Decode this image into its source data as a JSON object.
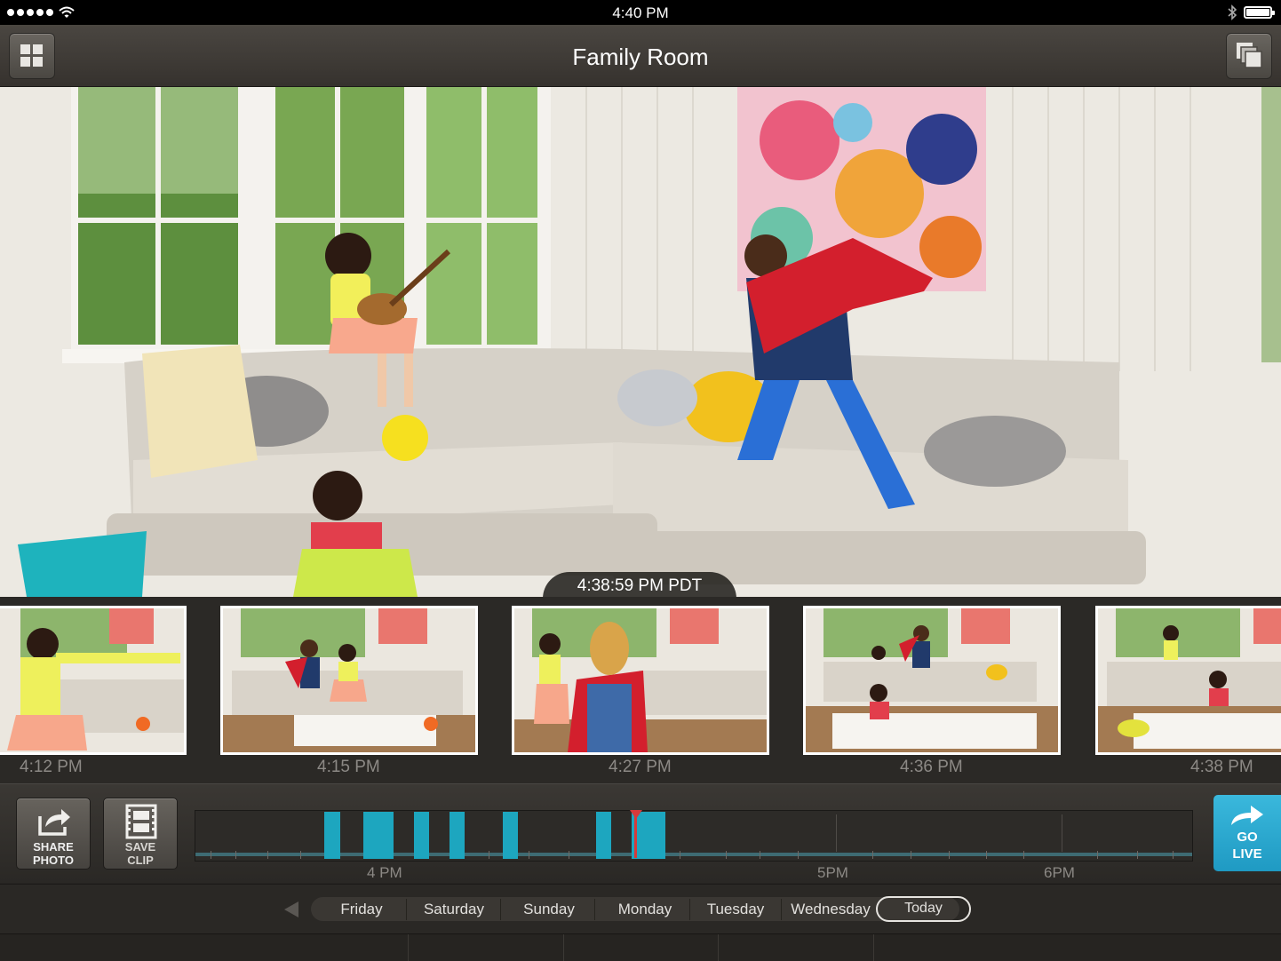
{
  "status_bar": {
    "time": "4:40 PM"
  },
  "header": {
    "title": "Family Room"
  },
  "camera": {
    "timestamp": "4:38:59 PM PDT"
  },
  "thumbnails": [
    {
      "time": "4:12 PM"
    },
    {
      "time": "4:15 PM"
    },
    {
      "time": "4:27 PM"
    },
    {
      "time": "4:36 PM"
    },
    {
      "time": "4:38 PM"
    }
  ],
  "actions": {
    "share_line1": "SHARE",
    "share_line2": "PHOTO",
    "save_line1": "SAVE",
    "save_line2": "CLIP",
    "live_line1": "GO",
    "live_line2": "LIVE"
  },
  "timeline": {
    "hour_labels": [
      "4 PM",
      "5PM",
      "6PM"
    ],
    "accent_color": "#1da6bf",
    "playhead_color": "#d63a3a"
  },
  "days": [
    "Friday",
    "Saturday",
    "Sunday",
    "Monday",
    "Tuesday",
    "Wednesday",
    "Today"
  ],
  "selected_day": "Today"
}
